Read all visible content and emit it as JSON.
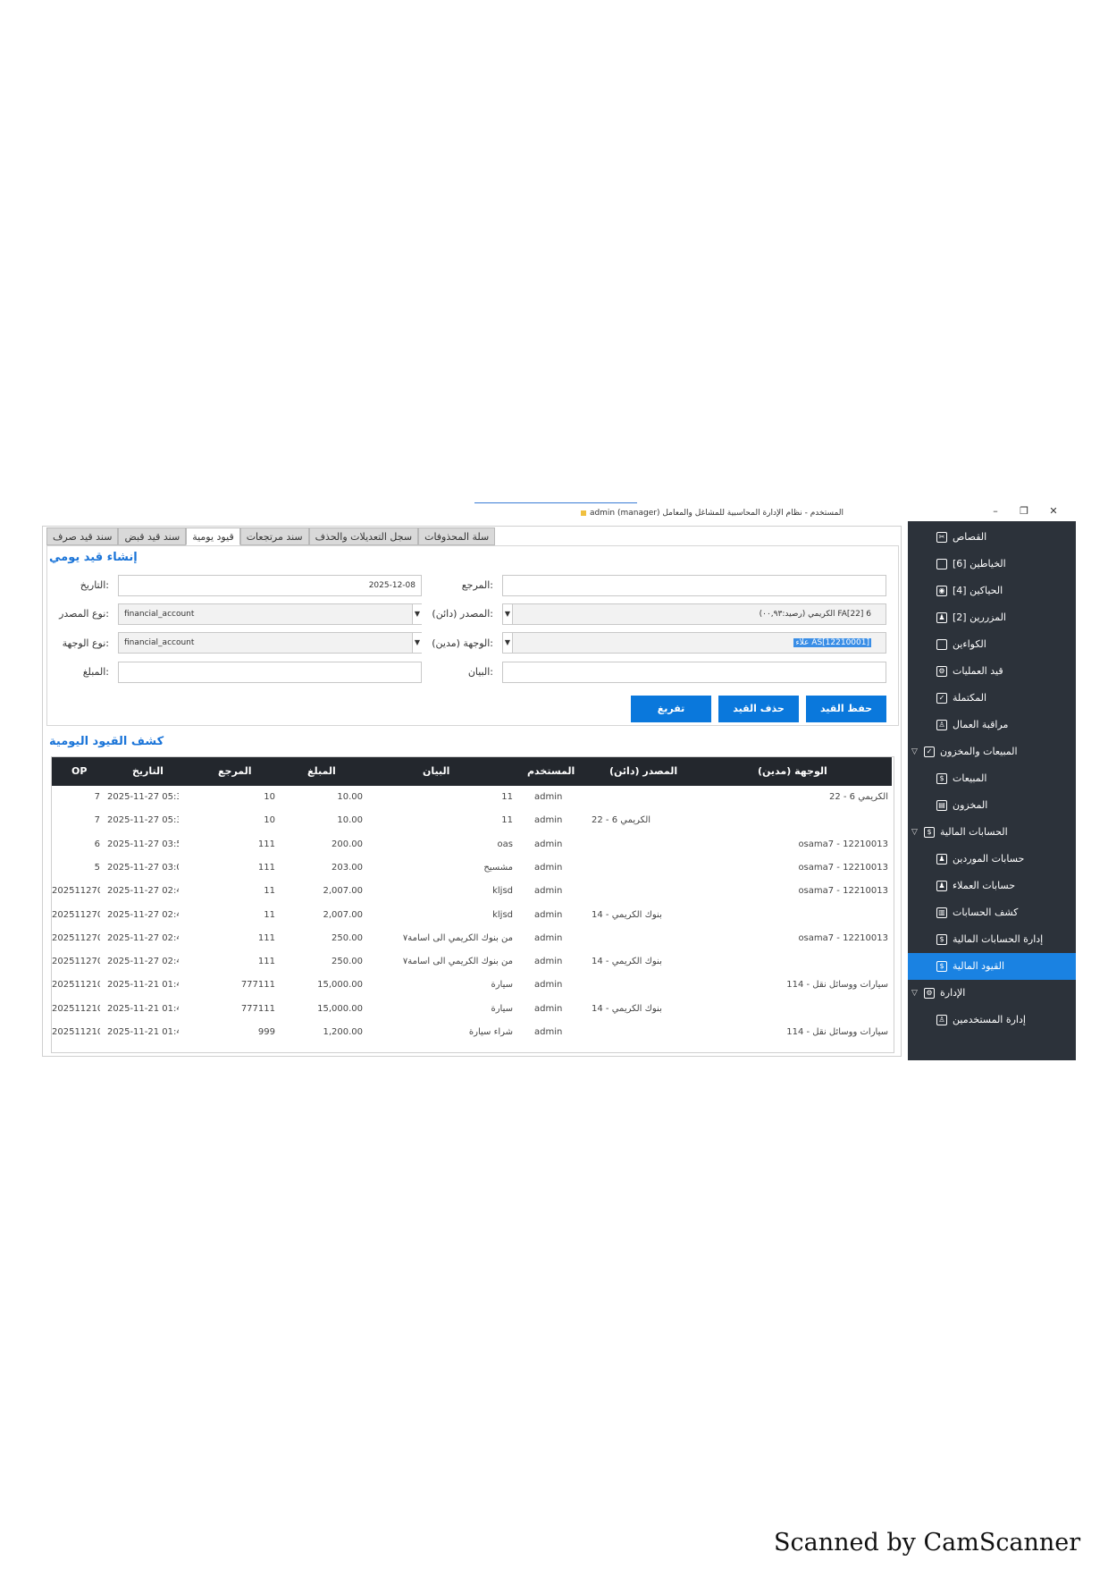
{
  "window": {
    "title": "المستخدم - نظام الإدارة المحاسبية للمشاغل والمعامل admin (manager)",
    "controls": [
      "–",
      "❐",
      "✕"
    ]
  },
  "tabs": [
    {
      "label": "سند قيد صرف"
    },
    {
      "label": "سند قيد قبض"
    },
    {
      "label": "قيود يومية",
      "active": true
    },
    {
      "label": "سند مرتجعات"
    },
    {
      "label": "سجل التعديلات والحذف"
    },
    {
      "label": "سلة المحذوفات"
    }
  ],
  "form": {
    "title": "إنشاء قيد يومي",
    "date_label": ":التاريخ",
    "date_value": "2025-12-08",
    "ref_label": ":المرجع",
    "ref_value": "",
    "src_type_label": ":نوع المصدر",
    "src_type_value": "financial_account",
    "src_label": ":المصدر (دائن)",
    "src_value": "FA[22] 6 الكريمي (رصيد:٠٠,٩٣)",
    "dst_type_label": ":نوع الوجهة",
    "dst_type_value": "financial_account",
    "dst_label": ":الوجهة (مدين)",
    "dst_value": "AS[12210001] علاء",
    "amount_label": ":المبلغ",
    "amount_value": "",
    "desc_label": ":البيان",
    "desc_value": "",
    "buttons": {
      "save": "حفظ القيد",
      "delete": "حذف القيد",
      "clear": "تفريغ"
    }
  },
  "table": {
    "title": "كشف القيود اليومية",
    "headers": {
      "op": "OP",
      "date": "التاريخ",
      "ref": "المرجع",
      "amount": "المبلغ",
      "desc": "البيان",
      "user": "المستخدم",
      "src": "المصدر (دائن)",
      "dst": "الوجهة (مدين)"
    },
    "rows": [
      {
        "op": "7",
        "date": "2025-11-27 05:3(",
        "ref": "10",
        "amount": "10.00",
        "desc": "11",
        "user": "admin",
        "src": "",
        "dst": "الكريمي 6 - 22"
      },
      {
        "op": "7",
        "date": "2025-11-27 05:3(",
        "ref": "10",
        "amount": "10.00",
        "desc": "11",
        "user": "admin",
        "src": "الكريمي 6 - 22",
        "dst": ""
      },
      {
        "op": "6",
        "date": "2025-11-27 03:5(",
        "ref": "111",
        "amount": "200.00",
        "desc": "oas",
        "user": "admin",
        "src": "",
        "dst": "12210013 - osama7"
      },
      {
        "op": "5",
        "date": "2025-11-27 03:0?",
        "ref": "111",
        "amount": "203.00",
        "desc": "مشسيح",
        "user": "admin",
        "src": "",
        "dst": "12210013 - osama7"
      },
      {
        "op": "202511270",
        "date": "2025-11-27 02:4?",
        "ref": "11",
        "amount": "2,007.00",
        "desc": "kljsd",
        "user": "admin",
        "src": "",
        "dst": "12210013 - osama7"
      },
      {
        "op": "202511270",
        "date": "2025-11-27 02:4?",
        "ref": "11",
        "amount": "2,007.00",
        "desc": "kljsd",
        "user": "admin",
        "src": "بنوك الكريمي - 14",
        "dst": ""
      },
      {
        "op": "202511270",
        "date": "2025-11-27 02:4(",
        "ref": "111",
        "amount": "250.00",
        "desc": "من بنوك الكريمي الى اسامة٧",
        "user": "admin",
        "src": "",
        "dst": "12210013 - osama7"
      },
      {
        "op": "202511270",
        "date": "2025-11-27 02:4(",
        "ref": "111",
        "amount": "250.00",
        "desc": "من بنوك الكريمي الى اسامة٧",
        "user": "admin",
        "src": "بنوك الكريمي - 14",
        "dst": ""
      },
      {
        "op": "202511210",
        "date": "2025-11-21 01:4(",
        "ref": "777111",
        "amount": "15,000.00",
        "desc": "سيارة",
        "user": "admin",
        "src": "",
        "dst": "سيارات ووسائل نقل - 114"
      },
      {
        "op": "202511210",
        "date": "2025-11-21 01:4(",
        "ref": "777111",
        "amount": "15,000.00",
        "desc": "سيارة",
        "user": "admin",
        "src": "بنوك الكريمي - 14",
        "dst": ""
      },
      {
        "op": "202511210",
        "date": "2025-11-21 01:4?",
        "ref": "999",
        "amount": "1,200.00",
        "desc": "شراء سيارة",
        "user": "admin",
        "src": "",
        "dst": "سيارات ووسائل نقل - 114"
      }
    ]
  },
  "sidebar": {
    "items": [
      {
        "label": "القصاص",
        "icon": "scissors-icon",
        "glyph": "✂",
        "level": 1
      },
      {
        "label": "الخياطين [6]",
        "icon": "square-icon",
        "glyph": "",
        "level": 1
      },
      {
        "label": "الحياكين [4]",
        "icon": "thread-icon",
        "glyph": "◉",
        "level": 1
      },
      {
        "label": "المزررين [2]",
        "icon": "worker-icon",
        "glyph": "♟",
        "level": 1
      },
      {
        "label": "الكواءين",
        "icon": "square-icon",
        "glyph": "",
        "level": 1
      },
      {
        "label": "قيد العمليات",
        "icon": "gear-icon",
        "glyph": "⚙",
        "level": 1
      },
      {
        "label": "المكتملة",
        "icon": "check-icon",
        "glyph": "✓",
        "level": 1
      },
      {
        "label": "مراقبة العمال",
        "icon": "monitor-icon",
        "glyph": "♙",
        "level": 1
      },
      {
        "label": "المبيعات والمخزون",
        "icon": "check-icon",
        "glyph": "✓",
        "level": 0,
        "chevron": "▽"
      },
      {
        "label": "المبيعات",
        "icon": "dollar-icon",
        "glyph": "$",
        "level": 1
      },
      {
        "label": "المخزون",
        "icon": "box-icon",
        "glyph": "▤",
        "level": 1
      },
      {
        "label": "الحسابات المالية",
        "icon": "money-icon",
        "glyph": "$",
        "level": 0,
        "chevron": "▽"
      },
      {
        "label": "حسابات الموردين",
        "icon": "people-icon",
        "glyph": "♟",
        "level": 1
      },
      {
        "label": "حسابات العملاء",
        "icon": "people-icon",
        "glyph": "♟",
        "level": 1
      },
      {
        "label": "كشف الحسابات",
        "icon": "chart-icon",
        "glyph": "▥",
        "level": 1
      },
      {
        "label": "إدارة الحسابات المالية",
        "icon": "money-icon",
        "glyph": "$",
        "level": 1
      },
      {
        "label": "القيود المالية",
        "icon": "money-icon",
        "glyph": "$",
        "level": 1,
        "active": true
      },
      {
        "label": "الإدارة",
        "icon": "gear-icon",
        "glyph": "⚙",
        "level": 0,
        "chevron": "▽"
      },
      {
        "label": "إدارة المستخدمين",
        "icon": "user-icon",
        "glyph": "♙",
        "level": 1
      }
    ]
  },
  "footer": {
    "scanned": "Scanned by CamScanner"
  },
  "colors": {
    "accent": "#1a82e2",
    "button": "#0a78dc",
    "sidebar": "#2c323a",
    "header": "#23272d"
  }
}
